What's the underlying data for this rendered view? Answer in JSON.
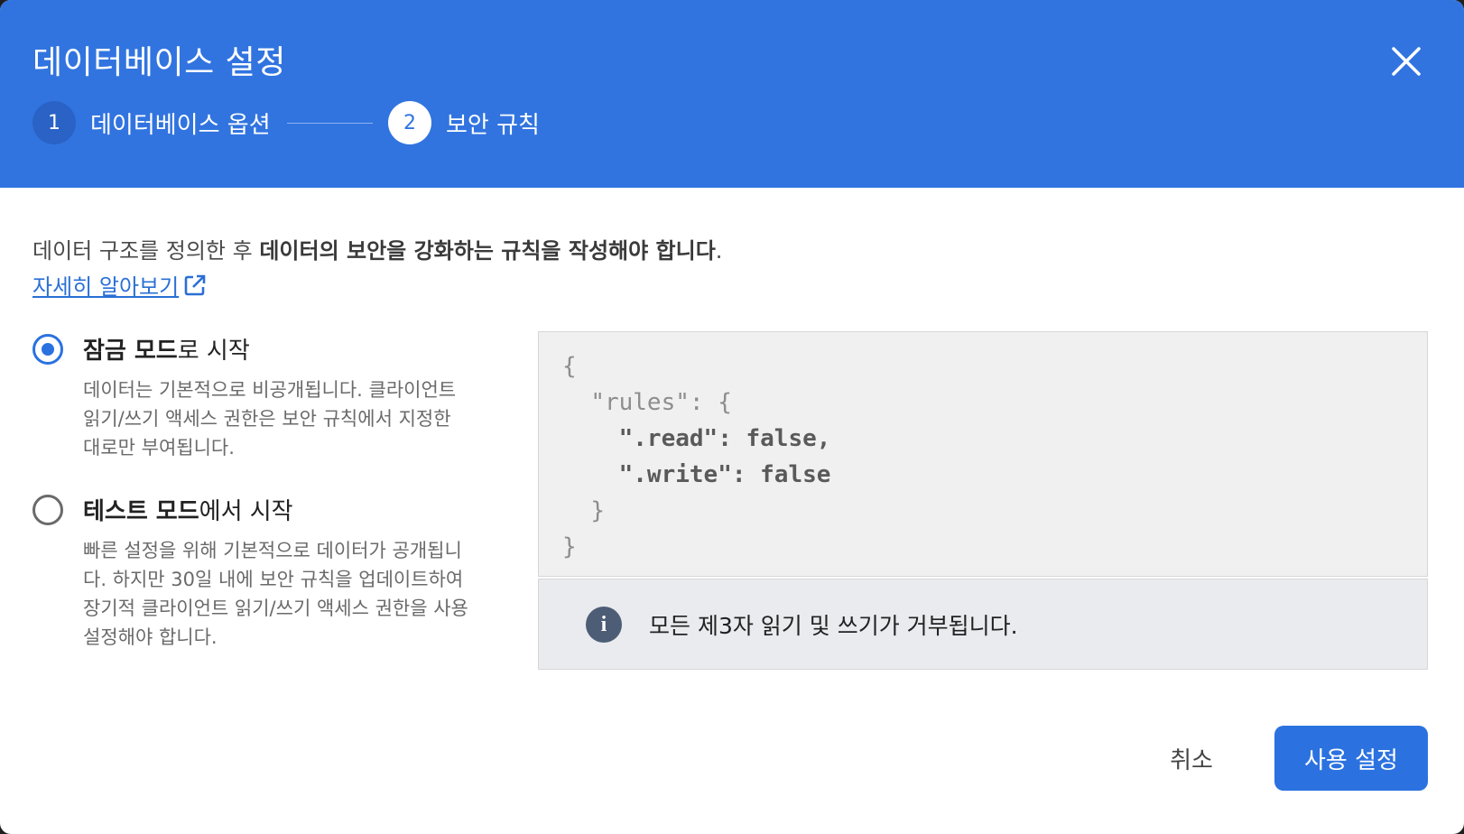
{
  "header": {
    "title": "데이터베이스 설정",
    "steps": [
      {
        "number": "1",
        "label": "데이터베이스 옵션"
      },
      {
        "number": "2",
        "label": "보안 규칙"
      }
    ]
  },
  "intro": {
    "text_before": "데이터 구조를 정의한 후 ",
    "text_bold": "데이터의 보안을 강화하는 규칙을 작성해야 합니다",
    "text_after": ".",
    "link_label": "자세히 알아보기"
  },
  "options": [
    {
      "title_bold": "잠금 모드",
      "title_rest": "로 시작",
      "description": "데이터는 기본적으로 비공개됩니다. 클라이언트 읽기/쓰기 액세스 권한은 보안 규칙에서 지정한 대로만 부여됩니다.",
      "selected": true
    },
    {
      "title_bold": "테스트 모드",
      "title_rest": "에서 시작",
      "description": "빠른 설정을 위해 기본적으로 데이터가 공개됩니다. 하지만 30일 내에 보안 규칙을 업데이트하여 장기적 클라이언트 읽기/쓰기 액세스 권한을 사용 설정해야 합니다.",
      "selected": false
    }
  ],
  "rules_code": {
    "open_brace": "{",
    "rules_key": "\"rules\": {",
    "read_line": "\".read\": false,",
    "write_line": "\".write\": false",
    "inner_close": "}",
    "close_brace": "}"
  },
  "info": {
    "icon": "info-icon",
    "text": "모든 제3자 읽기 및 쓰기가 거부됩니다."
  },
  "footer": {
    "cancel_label": "취소",
    "enable_label": "사용 설정"
  },
  "colors": {
    "header_bg": "#3174e0",
    "accent": "#2b72e0",
    "link": "#2a6fd6"
  }
}
